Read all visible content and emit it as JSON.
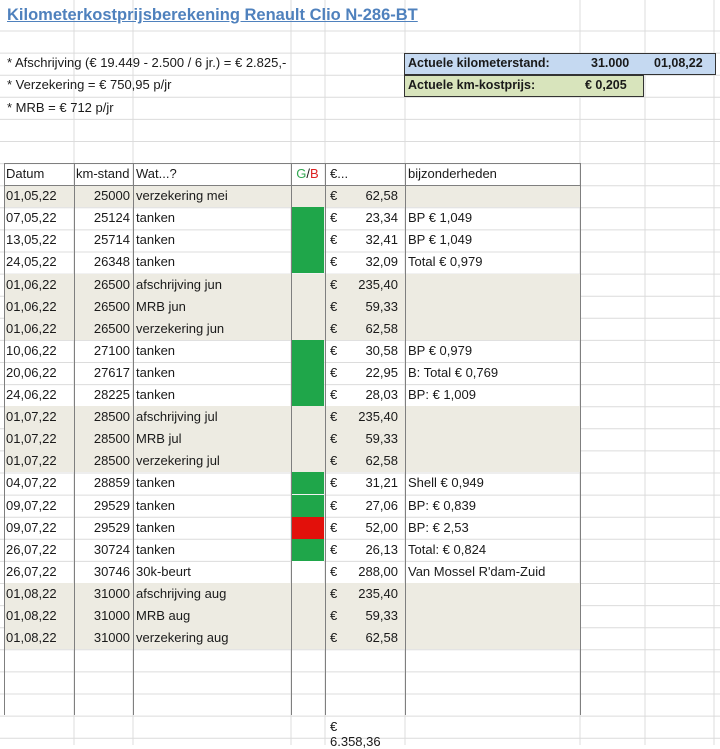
{
  "title": "Kilometerkostprijsberekening Renault Clio N-286-BT",
  "notes": [
    "* Afschrijving (€ 19.449 - 2.500 / 6 jr.) = € 2.825,-",
    "* Verzekering = € 750,95 p/jr",
    "* MRB = € 712 p/jr"
  ],
  "status": {
    "km_label": "Actuele kilometerstand:",
    "km_value": "31.000",
    "km_date": "01,08,22",
    "price_label": "Actuele km-kostprijs:",
    "price_value": "€  0,205"
  },
  "colors": {
    "fill_green": "#1fa64a",
    "fill_red": "#e2100b",
    "shade": "#edebe2",
    "title_blue": "#4f81bd"
  },
  "table": {
    "headers": {
      "date": "Datum",
      "km": "km-stand",
      "what": "Wat...?",
      "gb_g": "G",
      "gb_sep": "/",
      "gb_r": "B",
      "eur": "€...",
      "bij": "bijzonderheden"
    },
    "rows": [
      {
        "date": "01,05,22",
        "km": "25000",
        "what": "verzekering mei",
        "gb": "",
        "eur": "€",
        "amt": "62,58",
        "bij": "",
        "shade": true
      },
      {
        "date": "07,05,22",
        "km": "25124",
        "what": "tanken",
        "gb": "G",
        "eur": "€",
        "amt": "23,34",
        "bij": "BP € 1,049",
        "shade": false
      },
      {
        "date": "13,05,22",
        "km": "25714",
        "what": "tanken",
        "gb": "G",
        "eur": "€",
        "amt": "32,41",
        "bij": "BP € 1,049",
        "shade": false
      },
      {
        "date": "24,05,22",
        "km": "26348",
        "what": "tanken",
        "gb": "G",
        "eur": "€",
        "amt": "32,09",
        "bij": "Total € 0,979",
        "shade": false
      },
      {
        "date": "01,06,22",
        "km": "26500",
        "what": "afschrijving jun",
        "gb": "",
        "eur": "€",
        "amt": "235,40",
        "bij": "",
        "shade": true
      },
      {
        "date": "01,06,22",
        "km": "26500",
        "what": "MRB jun",
        "gb": "",
        "eur": "€",
        "amt": "59,33",
        "bij": "",
        "shade": true
      },
      {
        "date": "01,06,22",
        "km": "26500",
        "what": "verzekering jun",
        "gb": "",
        "eur": "€",
        "amt": "62,58",
        "bij": "",
        "shade": true
      },
      {
        "date": "10,06,22",
        "km": "27100",
        "what": "tanken",
        "gb": "G",
        "eur": "€",
        "amt": "30,58",
        "bij": "BP € 0,979",
        "shade": false
      },
      {
        "date": "20,06,22",
        "km": "27617",
        "what": "tanken",
        "gb": "G",
        "eur": "€",
        "amt": "22,95",
        "bij": "B: Total € 0,769",
        "shade": false
      },
      {
        "date": "24,06,22",
        "km": "28225",
        "what": "tanken",
        "gb": "G",
        "eur": "€",
        "amt": "28,03",
        "bij": "BP: € 1,009",
        "shade": false
      },
      {
        "date": "01,07,22",
        "km": "28500",
        "what": "afschrijving jul",
        "gb": "",
        "eur": "€",
        "amt": "235,40",
        "bij": "",
        "shade": true
      },
      {
        "date": "01,07,22",
        "km": "28500",
        "what": "MRB jul",
        "gb": "",
        "eur": "€",
        "amt": "59,33",
        "bij": "",
        "shade": true
      },
      {
        "date": "01,07,22",
        "km": "28500",
        "what": "verzekering jul",
        "gb": "",
        "eur": "€",
        "amt": "62,58",
        "bij": "",
        "shade": true
      },
      {
        "date": "04,07,22",
        "km": "28859",
        "what": "tanken",
        "gb": "G",
        "eur": "€",
        "amt": "31,21",
        "bij": "Shell € 0,949",
        "shade": false
      },
      {
        "date": "09,07,22",
        "km": "29529",
        "what": "tanken",
        "gb": "G",
        "eur": "€",
        "amt": "27,06",
        "bij": "BP: € 0,839",
        "shade": false
      },
      {
        "date": "09,07,22",
        "km": "29529",
        "what": "tanken",
        "gb": "B",
        "eur": "€",
        "amt": "52,00",
        "bij": "BP: € 2,53",
        "shade": false
      },
      {
        "date": "26,07,22",
        "km": "30724",
        "what": "tanken",
        "gb": "G",
        "eur": "€",
        "amt": "26,13",
        "bij": "Total: € 0,824",
        "shade": false
      },
      {
        "date": "26,07,22",
        "km": "30746",
        "what": "30k-beurt",
        "gb": "",
        "eur": "€",
        "amt": "288,00",
        "bij": "Van Mossel R'dam-Zuid",
        "shade": false
      },
      {
        "date": "01,08,22",
        "km": "31000",
        "what": "afschrijving aug",
        "gb": "",
        "eur": "€",
        "amt": "235,40",
        "bij": "",
        "shade": true
      },
      {
        "date": "01,08,22",
        "km": "31000",
        "what": "MRB aug",
        "gb": "",
        "eur": "€",
        "amt": "59,33",
        "bij": "",
        "shade": true
      },
      {
        "date": "01,08,22",
        "km": "31000",
        "what": "verzekering aug",
        "gb": "",
        "eur": "€",
        "amt": "62,58",
        "bij": "",
        "shade": true
      }
    ],
    "total": "€ 6.358,36"
  }
}
